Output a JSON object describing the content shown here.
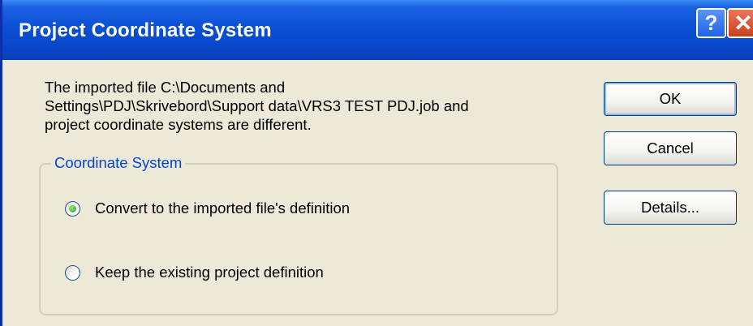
{
  "window": {
    "title": "Project Coordinate System",
    "help_glyph": "?",
    "close_glyph": "✕"
  },
  "message": {
    "lines": [
      "The imported file C:\\Documents and",
      "Settings\\PDJ\\Skrivebord\\Support data\\VRS3 TEST PDJ.job and",
      "project coordinate systems are different."
    ]
  },
  "group": {
    "label": "Coordinate System",
    "options": [
      {
        "label": "Convert to the imported file's definition",
        "selected": true
      },
      {
        "label": "Keep the existing project definition",
        "selected": false
      }
    ]
  },
  "buttons": {
    "ok": "OK",
    "cancel": "Cancel",
    "details": "Details..."
  },
  "colors": {
    "titlebar": "#0a4fd6",
    "dialog_bg": "#ece9d8",
    "group_label": "#0046d5",
    "radio_selected": "#21a121"
  },
  "icons": {
    "help": "help-icon",
    "close": "close-icon"
  }
}
